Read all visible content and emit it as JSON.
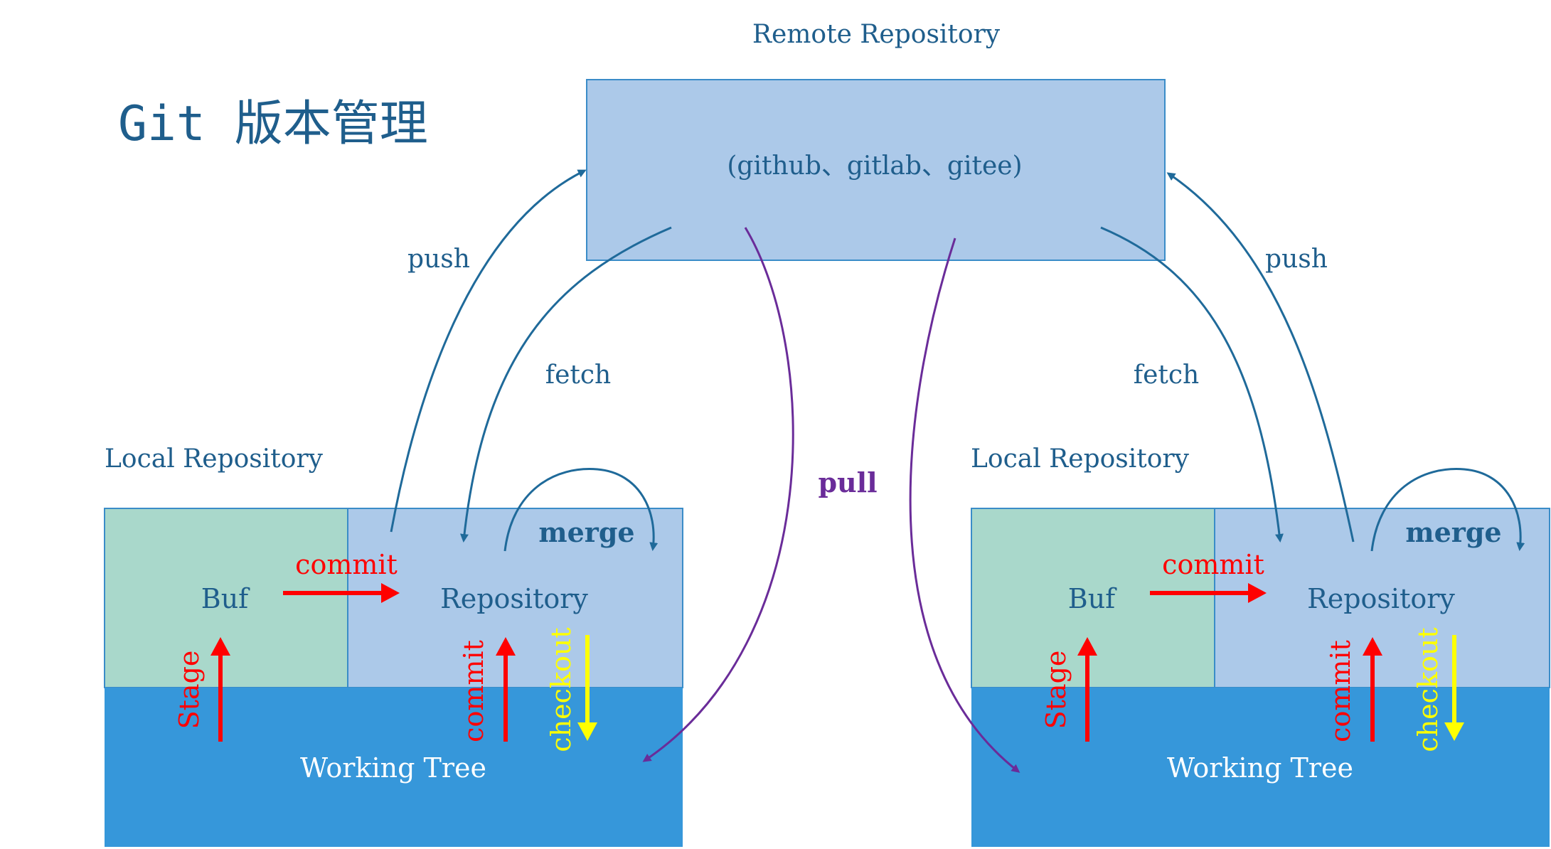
{
  "title": "Git 版本管理",
  "remote": {
    "heading": "Remote Repository",
    "hosts": "(github、gitlab、gitee)"
  },
  "arrows": {
    "push": "push",
    "fetch": "fetch",
    "pull": "pull",
    "merge": "merge",
    "commit": "commit",
    "stage": "Stage",
    "checkout": "checkout"
  },
  "local_left": {
    "heading": "Local Repository",
    "buf": "Buf",
    "repository": "Repository",
    "working_tree": "Working Tree"
  },
  "local_right": {
    "heading": "Local Repository",
    "buf": "Buf",
    "repository": "Repository",
    "working_tree": "Working Tree"
  },
  "colors": {
    "text_blue": "#1F5E8C",
    "remote_fill": "#ACC9E9",
    "remote_border": "#3A8CC8",
    "buf_fill": "#A9D8CB",
    "repo_fill": "#ACC9E9",
    "working_fill": "#3697DA",
    "arrow_blue": "#1F6A9A",
    "pull_purple": "#6A2C99",
    "commit_red": "#FF0000",
    "checkout_yellow": "#FFFF00",
    "white": "#FFFFFF"
  }
}
